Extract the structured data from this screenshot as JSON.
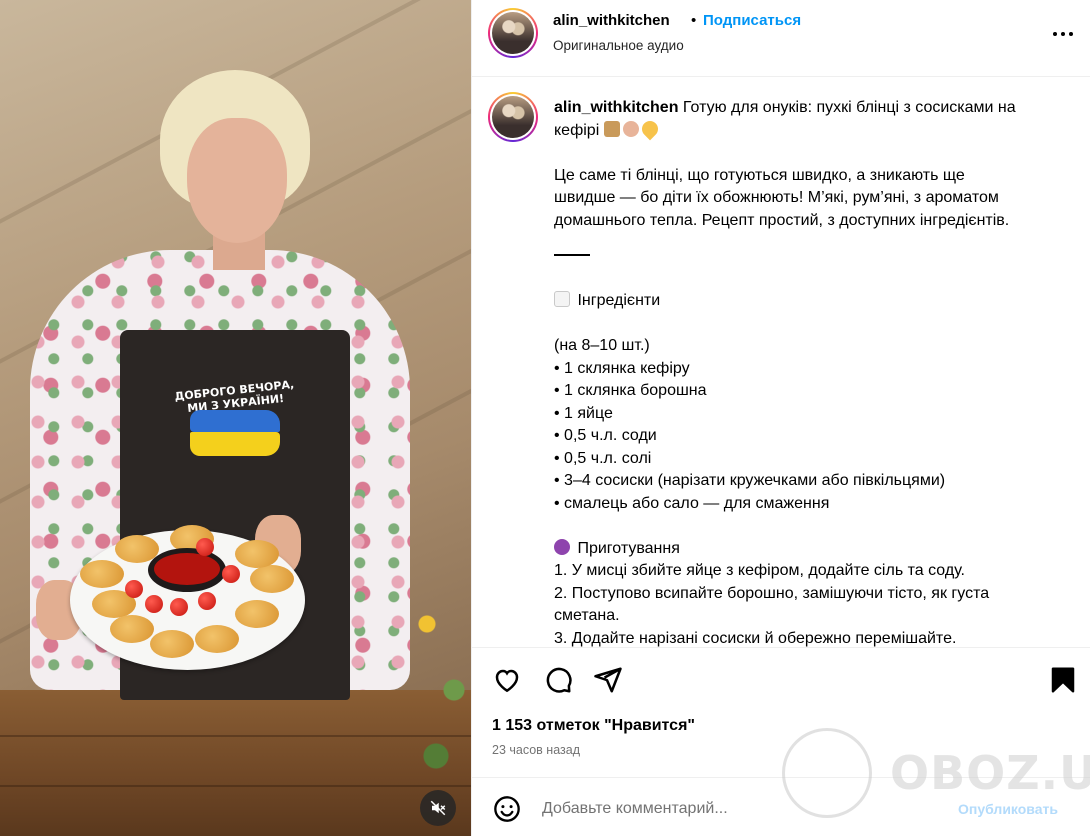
{
  "header": {
    "username": "alin_withkitchen",
    "separator": "•",
    "follow_label": "Подписаться",
    "audio_label": "Оригинальное аудио"
  },
  "caption": {
    "username": "alin_withkitchen",
    "title": "Готую для онуків: пухкі блінці з сосисками на кефірі",
    "intro": [
      "Це саме ті блінці, що готуються швидко, а зникають ще",
      "швидше — бо діти їх обожнюють! М’які, рум’яні, з ароматом",
      "домашнього тепла. Рецепт простий, з доступних інгредієнтів."
    ],
    "ingredients_heading": "Інгредієнти",
    "ingredients": [
      "(на 8–10 шт.)",
      "• 1 склянка кефіру",
      "• 1 склянка борошна",
      "• 1 яйце",
      "• 0,5 ч.л. соди",
      "• 0,5 ч.л. солі",
      "• 3–4 сосиски (нарізати кружечками або півкільцями)",
      "• смалець або сало — для смаження"
    ],
    "method_heading": "Приготування",
    "method": [
      "1. У мисці збийте яйце з кефіром, додайте сіль та соду.",
      "2. Поступово всипайте борошно, замішуючи тісто, як густа",
      "сметана.",
      "3. Додайте нарізані сосиски й обережно перемішайте."
    ]
  },
  "video": {
    "apron_text": "ДОБРОГО ВЕЧОРА, МИ З УКРАЇНИ!"
  },
  "actions": {
    "likes_text": "1 153 отметок \"Нравится\"",
    "time_text": "23 часов назад"
  },
  "comment": {
    "placeholder": "Добавьте комментарий...",
    "post_label": "Опубликовать"
  },
  "watermark": {
    "text": "OBOZ.UA"
  },
  "icons": {
    "like": "heart-icon",
    "comment": "comment-icon",
    "share": "send-icon",
    "save": "bookmark-icon",
    "more": "more-icon",
    "emoji": "smile-icon",
    "mute": "muted-speaker-icon"
  },
  "colors": {
    "accent": "#0095f6",
    "post_disabled": "#b3dbfb",
    "secondary_text": "#737373"
  }
}
